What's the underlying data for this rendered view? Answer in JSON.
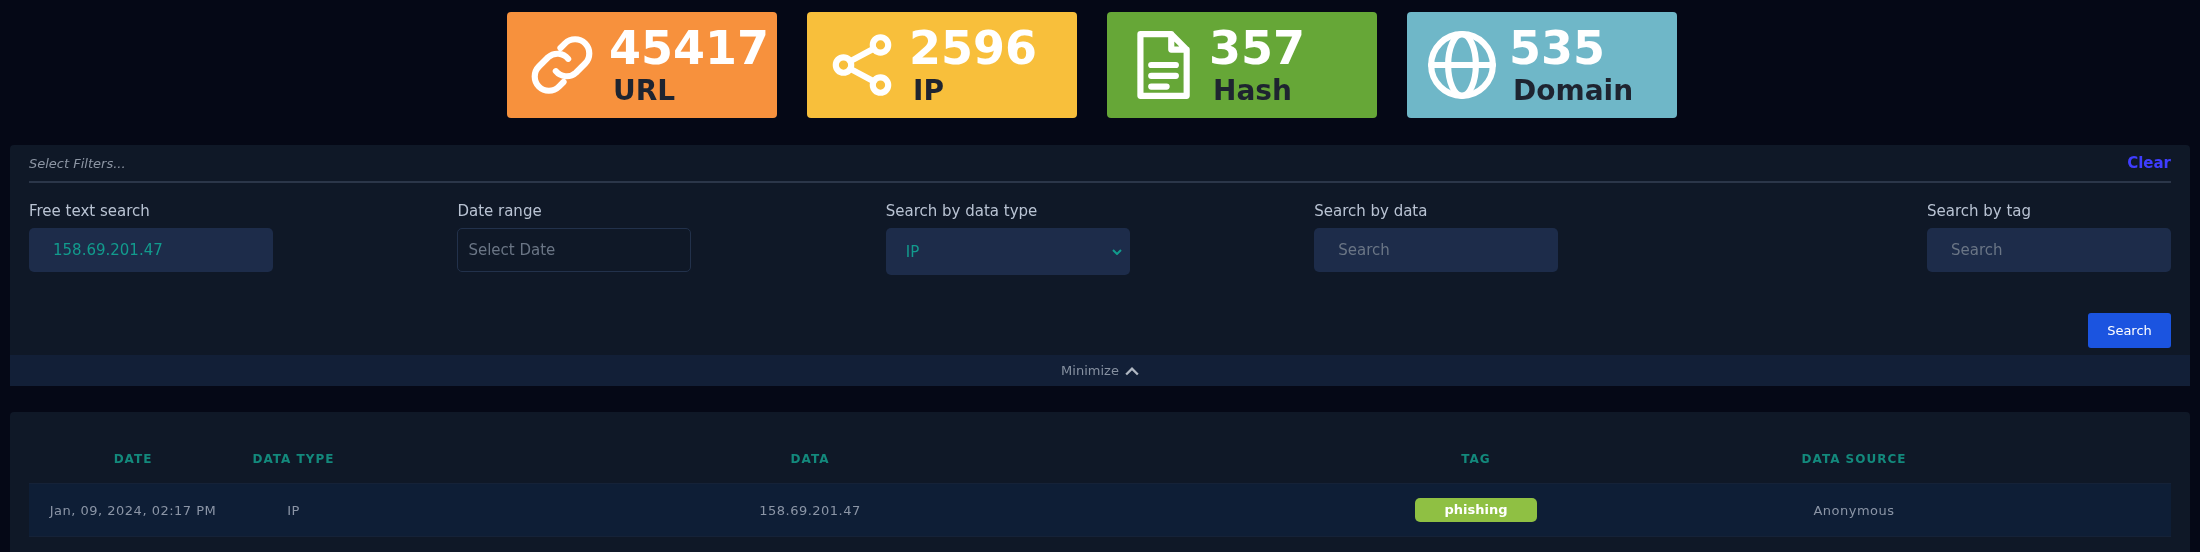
{
  "stats": [
    {
      "kind": "link",
      "count": "45417",
      "label": "URL",
      "color": "#f7913d"
    },
    {
      "kind": "share",
      "count": "2596",
      "label": "IP",
      "color": "#f8bf3b"
    },
    {
      "kind": "file",
      "count": "357",
      "label": "Hash",
      "color": "#66a737"
    },
    {
      "kind": "globe",
      "count": "535",
      "label": "Domain",
      "color": "#6fb7c8"
    }
  ],
  "filters": {
    "placeholder": "Select Filters...",
    "clear": "Clear",
    "fields": [
      {
        "kind": "text",
        "label": "Free text search",
        "value": "158.69.201.47"
      },
      {
        "kind": "date",
        "label": "Date range",
        "placeholder": "Select Date"
      },
      {
        "kind": "select",
        "label": "Search by data type",
        "value": "IP"
      },
      {
        "kind": "text",
        "label": "Search by data",
        "placeholder": "Search"
      },
      {
        "kind": "text",
        "label": "Search by tag",
        "placeholder": "Search"
      }
    ],
    "search_button": "Search",
    "minimize": "Minimize"
  },
  "table": {
    "columns": [
      "DATE",
      "DATA TYPE",
      "DATA",
      "TAG",
      "DATA SOURCE"
    ],
    "rows": [
      {
        "date": "Jan, 09, 2024, 02:17 PM",
        "data_type": "IP",
        "data": "158.69.201.47",
        "tag": "phishing",
        "data_source": "Anonymous"
      }
    ]
  }
}
